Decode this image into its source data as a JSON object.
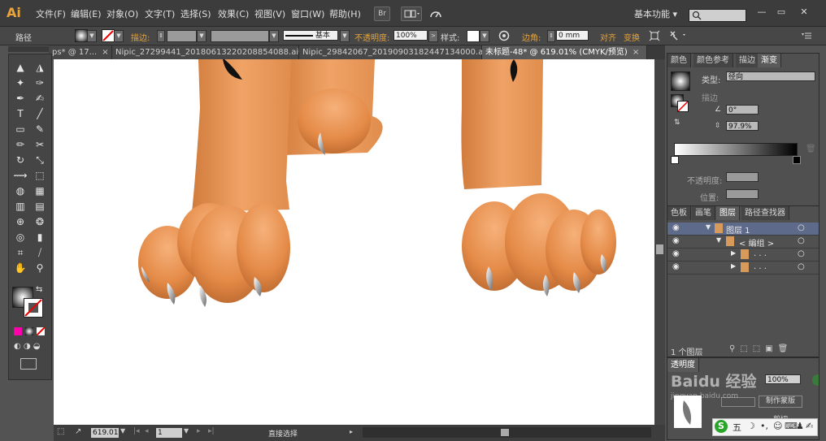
{
  "app": {
    "logo": "Ai"
  },
  "menu": [
    "文件(F)",
    "编辑(E)",
    "对象(O)",
    "文字(T)",
    "选择(S)",
    "效果(C)",
    "视图(V)",
    "窗口(W)",
    "帮助(H)"
  ],
  "bridge_label": "Br",
  "workspace": {
    "label": "基本功能 ▾"
  },
  "window_controls": {
    "minimize": "—",
    "restore": "▭",
    "close": "✕"
  },
  "control_bar": {
    "object_type": "路径",
    "stroke_label": "描边:",
    "stroke_style": "基本",
    "opacity_label": "不透明度:",
    "opacity_value": "100%",
    "style_label": "样式:",
    "corner_label": "边角:",
    "corner_value": "0 mm",
    "align_label": "对齐",
    "transform_label": "变换"
  },
  "doc_tabs": [
    {
      "label": "ps* @ 17...",
      "active": false
    },
    {
      "label": "Nipic_27299441_20180613220208854088.ai*",
      "active": false
    },
    {
      "label": "Nipic_29842067_20190903182447134000.ai*",
      "active": false
    },
    {
      "label": "未标题-48* @ 619.01% (CMYK/预览)",
      "active": true
    }
  ],
  "tab_close": "×",
  "tools": [
    [
      "▲",
      "◮"
    ],
    [
      "✦",
      "✑"
    ],
    [
      "✒",
      "✍"
    ],
    [
      "T",
      "╱"
    ],
    [
      "▭",
      "✎"
    ],
    [
      "✏",
      "✂"
    ],
    [
      "↻",
      "⤡"
    ],
    [
      "⟿",
      "⬚"
    ],
    [
      "◍",
      "▦"
    ],
    [
      "▥",
      "▤"
    ],
    [
      "⊕",
      "❂"
    ],
    [
      "◎",
      "▮"
    ],
    [
      "⌗",
      "⧸"
    ],
    [
      "✋",
      "⚲"
    ]
  ],
  "gradient_panel": {
    "tabs": [
      "颜色",
      "颜色参考",
      "描边",
      "渐变"
    ],
    "type_label": "类型:",
    "type_value": "径向",
    "stroke_label": "描边",
    "angle_value": "0°",
    "aspect_value": "97.9%",
    "opacity_label": "不透明度:",
    "position_label": "位置:"
  },
  "layers_panel": {
    "tabs": [
      "色板",
      "画笔",
      "图层",
      "路径查找器"
    ],
    "rows": [
      {
        "name": "图层 1",
        "indent": 0,
        "expanded": true
      },
      {
        "name": "< 编组 >",
        "indent": 1,
        "expanded": true
      },
      {
        "name": ". . .",
        "indent": 2,
        "expanded": false
      },
      {
        "name": ". . .",
        "indent": 2,
        "expanded": false
      }
    ],
    "footer": "1 个图层"
  },
  "bottom_panel": {
    "transparency_tab": "透明度",
    "opacity_value": "100%",
    "make_mask": "制作蒙版",
    "clip": "剪切"
  },
  "watermark": "Baidu 经验",
  "watermark_url": "jingyan.baidu.com",
  "ime_bar": {
    "s": "S",
    "label": "五",
    "moon": "☽",
    "punc": "•,",
    "emoji": "☺",
    "kbd": "⌨",
    "user": "♟",
    "wrench": "✍"
  },
  "status_bar": {
    "zoom": "619.01",
    "page": "1",
    "tool_name": "直接选择"
  }
}
